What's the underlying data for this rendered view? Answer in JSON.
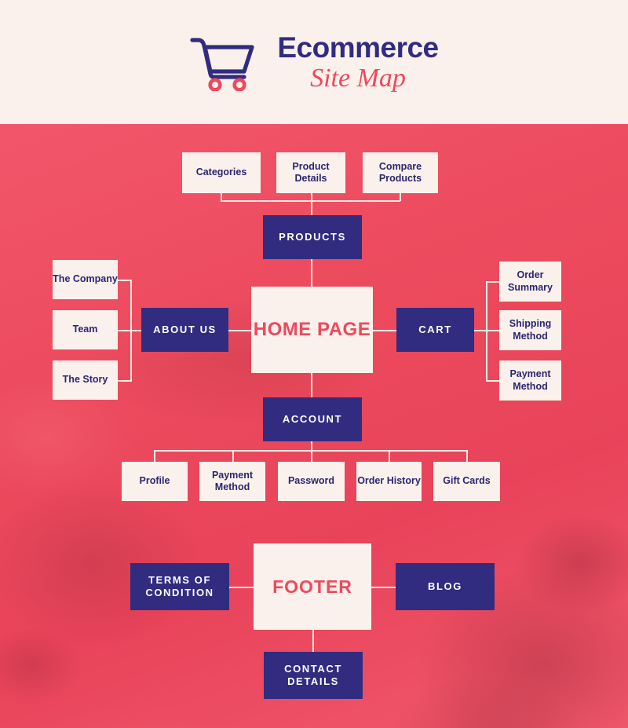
{
  "header": {
    "icon": "shopping-cart-icon",
    "title_main": "Ecommerce",
    "title_sub": "Site Map"
  },
  "colors": {
    "navy": "#312c80",
    "coral": "#f0485c",
    "cream": "#faf1ec",
    "background": "#ec4a5d",
    "connector": "#f7e9e3"
  },
  "diagram": {
    "type": "site-map-tree",
    "root": "HOME PAGE",
    "nodes": {
      "categories": "Categories",
      "product_details": "Product Details",
      "compare_products": "Compare Products",
      "products": "PRODUCTS",
      "the_company": "The Company",
      "team": "Team",
      "the_story": "The Story",
      "about_us": "ABOUT US",
      "home_page": "HOME PAGE",
      "cart": "CART",
      "order_summary": "Order Summary",
      "shipping_method": "Shipping Method",
      "payment_method_cart": "Payment Method",
      "account": "ACCOUNT",
      "profile": "Profile",
      "payment_method_account": "Payment Method",
      "password": "Password",
      "order_history": "Order History",
      "gift_cards": "Gift Cards",
      "footer": "FOOTER",
      "terms_of_condition": "TERMS OF CONDITION",
      "blog": "BLOG",
      "contact_details": "CONTACT DETAILS"
    },
    "edges": [
      [
        "products",
        "categories"
      ],
      [
        "products",
        "product_details"
      ],
      [
        "products",
        "compare_products"
      ],
      [
        "home_page",
        "products"
      ],
      [
        "home_page",
        "about_us"
      ],
      [
        "home_page",
        "cart"
      ],
      [
        "home_page",
        "account"
      ],
      [
        "about_us",
        "the_company"
      ],
      [
        "about_us",
        "team"
      ],
      [
        "about_us",
        "the_story"
      ],
      [
        "cart",
        "order_summary"
      ],
      [
        "cart",
        "shipping_method"
      ],
      [
        "cart",
        "payment_method_cart"
      ],
      [
        "account",
        "profile"
      ],
      [
        "account",
        "payment_method_account"
      ],
      [
        "account",
        "password"
      ],
      [
        "account",
        "order_history"
      ],
      [
        "account",
        "gift_cards"
      ],
      [
        "footer",
        "terms_of_condition"
      ],
      [
        "footer",
        "blog"
      ],
      [
        "footer",
        "contact_details"
      ]
    ]
  }
}
